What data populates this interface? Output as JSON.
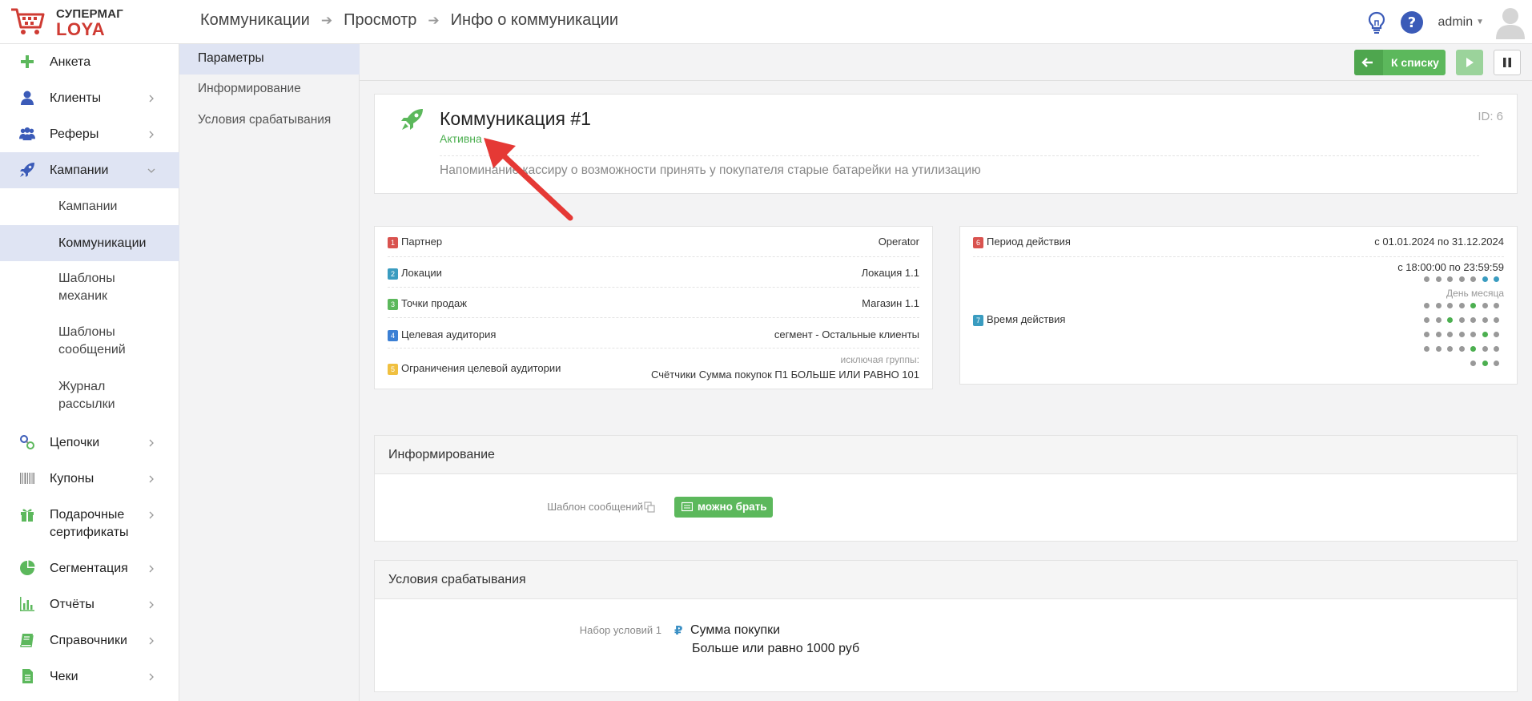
{
  "logo": {
    "top": "СУПЕРМАГ",
    "bottom": "LOYA"
  },
  "breadcrumb": [
    "Коммуникации",
    "Просмотр",
    "Инфо о коммуникации"
  ],
  "user": {
    "name": "admin"
  },
  "sidebar": {
    "items": [
      {
        "label": "Анкета",
        "icon": "plus-icon"
      },
      {
        "label": "Клиенты",
        "icon": "user-icon"
      },
      {
        "label": "Реферы",
        "icon": "users-icon"
      },
      {
        "label": "Кампании",
        "icon": "rocket-icon"
      },
      {
        "label": "Цепочки",
        "icon": "chain-icon"
      },
      {
        "label": "Купоны",
        "icon": "barcode-icon"
      },
      {
        "label": "Подарочные сертификаты",
        "icon": "gift-icon"
      },
      {
        "label": "Сегментация",
        "icon": "pie-icon"
      },
      {
        "label": "Отчёты",
        "icon": "bar-chart-icon"
      },
      {
        "label": "Справочники",
        "icon": "book-icon"
      },
      {
        "label": "Чеки",
        "icon": "receipt-icon"
      }
    ],
    "subitems": [
      {
        "label": "Кампании"
      },
      {
        "label": "Коммуникации"
      },
      {
        "label": "Шаблоны механик"
      },
      {
        "label": "Шаблоны сообщений"
      },
      {
        "label": "Журнал рассылки"
      }
    ]
  },
  "subnav": [
    "Параметры",
    "Информирование",
    "Условия срабатывания"
  ],
  "toolbar": {
    "back_label": "К списку"
  },
  "communication": {
    "title": "Коммуникация #1",
    "status": "Активна",
    "id": "ID: 6",
    "description": "Напоминание кассиру о возможности принять у покупателя старые батарейки на утилизацию"
  },
  "params_left": [
    {
      "num": "1",
      "color": "#d9534f",
      "label": "Партнер",
      "value": "Operator"
    },
    {
      "num": "2",
      "color": "#3a9cc0",
      "label": "Локации",
      "value": "Локация 1.1"
    },
    {
      "num": "3",
      "color": "#5cb85c",
      "label": "Точки продаж",
      "value": "Магазин 1.1"
    },
    {
      "num": "4",
      "color": "#3b7fd4",
      "label": "Целевая аудитория",
      "value": "сегмент - Остальные клиенты"
    },
    {
      "num": "5",
      "color": "#f0c040",
      "label": "Ограничения целевой аудитории",
      "value_note": "исключая группы:",
      "value": "Счётчики Сумма покупок П1 БОЛЬШЕ ИЛИ РАВНО 101"
    }
  ],
  "params_right": {
    "period": {
      "num": "6",
      "color": "#d9534f",
      "label": "Период действия",
      "value": "с 01.01.2024 по 31.12.2024"
    },
    "time": {
      "num": "7",
      "color": "#3a9cc0",
      "label": "Время действия",
      "value": "с 18:00:00 по 23:59:59",
      "month_day_label": "День месяца"
    }
  },
  "info": {
    "heading": "Информирование",
    "template_label": "Шаблон сообщений",
    "template_value": "можно брать"
  },
  "conditions": {
    "heading": "Условия срабатывания",
    "set_label": "Набор условий 1",
    "condition_name": "Сумма покупки",
    "condition_value": "Больше или равно 1000 руб"
  },
  "colors": {
    "accent": "#5cb85c",
    "status_active": "#4caf50",
    "brand_red": "#cf3b33",
    "dot_active": "#4caf50",
    "dot_weekend": "#3a9cc0",
    "dot_inactive": "#999999"
  }
}
